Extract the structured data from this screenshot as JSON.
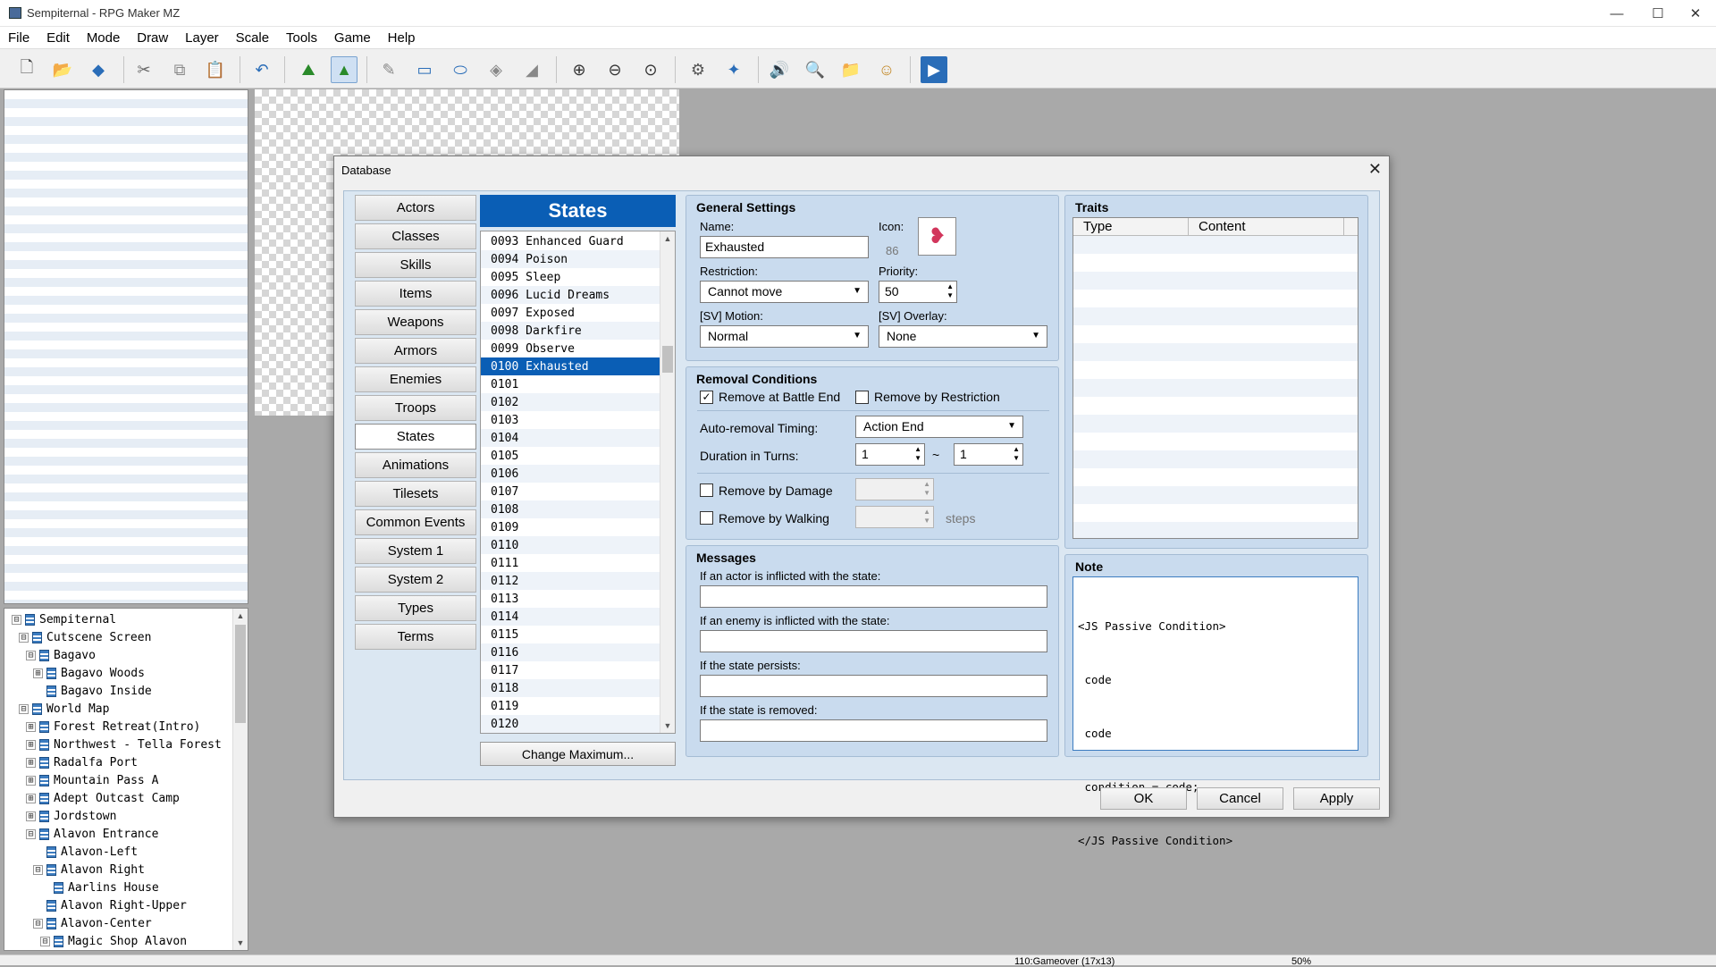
{
  "window": {
    "title": "Sempiternal - RPG Maker MZ",
    "minimize": "—",
    "maximize": "☐",
    "close": "✕"
  },
  "menu": [
    "File",
    "Edit",
    "Mode",
    "Draw",
    "Layer",
    "Scale",
    "Tools",
    "Game",
    "Help"
  ],
  "map_tree": [
    {
      "label": "Sempiternal",
      "depth": 0,
      "exp": "⊟"
    },
    {
      "label": "Cutscene Screen",
      "depth": 1,
      "exp": "⊟"
    },
    {
      "label": "Bagavo",
      "depth": 2,
      "exp": "⊟"
    },
    {
      "label": "Bagavo Woods",
      "depth": 3,
      "exp": "⊞"
    },
    {
      "label": "Bagavo Inside",
      "depth": 3,
      "exp": ""
    },
    {
      "label": "World Map",
      "depth": 1,
      "exp": "⊟"
    },
    {
      "label": "Forest Retreat(Intro)",
      "depth": 2,
      "exp": "⊞"
    },
    {
      "label": "Northwest - Tella Forest",
      "depth": 2,
      "exp": "⊞"
    },
    {
      "label": "Radalfa Port",
      "depth": 2,
      "exp": "⊞"
    },
    {
      "label": "Mountain Pass A",
      "depth": 2,
      "exp": "⊞"
    },
    {
      "label": "Adept Outcast Camp",
      "depth": 2,
      "exp": "⊞"
    },
    {
      "label": "Jordstown",
      "depth": 2,
      "exp": "⊞"
    },
    {
      "label": "Alavon Entrance",
      "depth": 2,
      "exp": "⊟"
    },
    {
      "label": "Alavon-Left",
      "depth": 3,
      "exp": ""
    },
    {
      "label": "Alavon Right",
      "depth": 3,
      "exp": "⊟"
    },
    {
      "label": "Aarlins House",
      "depth": 4,
      "exp": ""
    },
    {
      "label": "Alavon Right-Upper",
      "depth": 3,
      "exp": ""
    },
    {
      "label": "Alavon-Center",
      "depth": 3,
      "exp": "⊟"
    },
    {
      "label": "Magic Shop Alavon",
      "depth": 4,
      "exp": "⊟"
    }
  ],
  "status": {
    "map": "110:Gameover (17x13)",
    "zoom": "50%"
  },
  "dialog": {
    "title": "Database",
    "close": "✕",
    "nav": [
      "Actors",
      "Classes",
      "Skills",
      "Items",
      "Weapons",
      "Armors",
      "Enemies",
      "Troops",
      "States",
      "Animations",
      "Tilesets",
      "Common Events",
      "System 1",
      "System 2",
      "Types",
      "Terms"
    ],
    "active_nav": "States",
    "list_header": "States",
    "states": [
      "0093 Enhanced Guard",
      "0094 Poison",
      "0095 Sleep",
      "0096 Lucid Dreams",
      "0097 Exposed",
      "0098 Darkfire",
      "0099 Observe",
      "0100 Exhausted",
      "0101",
      "0102",
      "0103",
      "0104",
      "0105",
      "0106",
      "0107",
      "0108",
      "0109",
      "0110",
      "0111",
      "0112",
      "0113",
      "0114",
      "0115",
      "0116",
      "0117",
      "0118",
      "0119",
      "0120"
    ],
    "selected_state": "0100 Exhausted",
    "change_max": "Change Maximum...",
    "general": {
      "title": "General Settings",
      "name_label": "Name:",
      "name_value": "Exhausted",
      "icon_label": "Icon:",
      "icon_index": "86",
      "restriction_label": "Restriction:",
      "restriction_value": "Cannot move",
      "priority_label": "Priority:",
      "priority_value": "50",
      "motion_label": "[SV] Motion:",
      "motion_value": "Normal",
      "overlay_label": "[SV] Overlay:",
      "overlay_value": "None"
    },
    "removal": {
      "title": "Removal Conditions",
      "battle_end": "Remove at Battle End",
      "battle_end_checked": true,
      "restriction": "Remove by Restriction",
      "restriction_checked": false,
      "timing_label": "Auto-removal Timing:",
      "timing_value": "Action End",
      "duration_label": "Duration in Turns:",
      "duration_min": "1",
      "tilde": "~",
      "duration_max": "1",
      "damage": "Remove by Damage",
      "walking": "Remove by Walking",
      "steps": "steps"
    },
    "messages": {
      "title": "Messages",
      "actor": "If an actor is inflicted with the state:",
      "enemy": "If an enemy is inflicted with the state:",
      "persists": "If the state persists:",
      "removed": "If the state is removed:"
    },
    "traits": {
      "title": "Traits",
      "col_type": "Type",
      "col_content": "Content"
    },
    "note": {
      "title": "Note",
      "lines": [
        "<JS Passive Condition>",
        " code",
        " code",
        " condition = code;",
        "</JS Passive Condition>"
      ]
    },
    "buttons": {
      "ok": "OK",
      "cancel": "Cancel",
      "apply": "Apply"
    }
  },
  "colors": {
    "accent": "#0a5eb5",
    "panel": "#c9dbee"
  }
}
